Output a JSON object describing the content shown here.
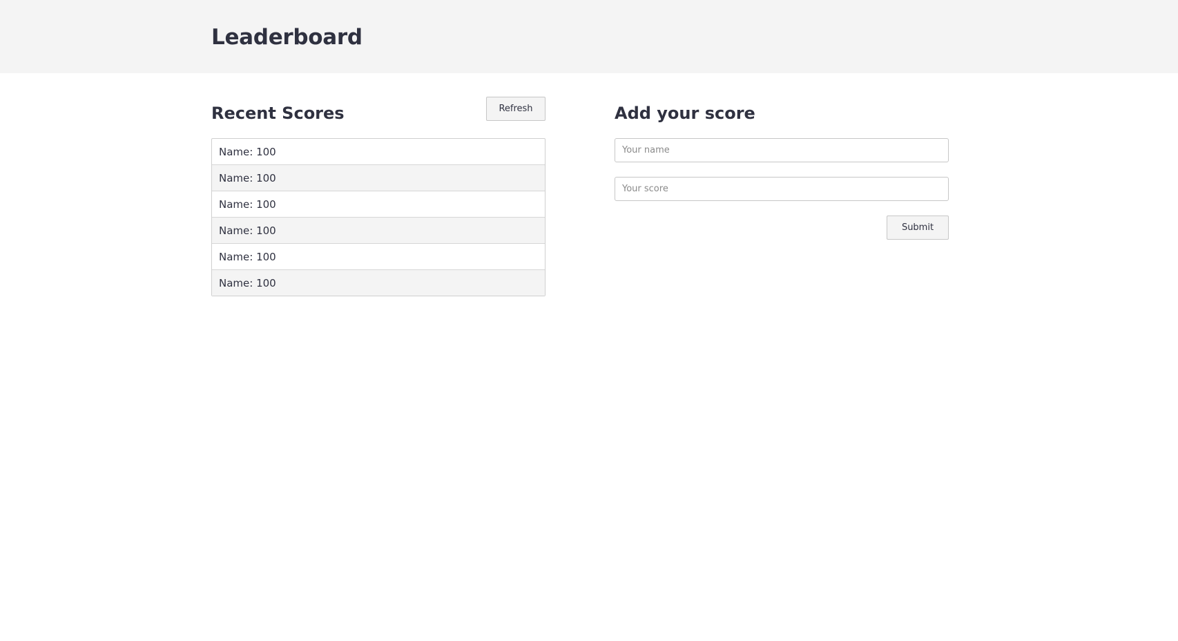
{
  "header": {
    "title": "Leaderboard"
  },
  "recent": {
    "title": "Recent Scores",
    "refresh_label": "Refresh",
    "items": [
      {
        "label": "Name: 100"
      },
      {
        "label": "Name: 100"
      },
      {
        "label": "Name: 100"
      },
      {
        "label": "Name: 100"
      },
      {
        "label": "Name: 100"
      },
      {
        "label": "Name: 100"
      }
    ]
  },
  "form": {
    "title": "Add your score",
    "name_placeholder": "Your name",
    "score_placeholder": "Your score",
    "submit_label": "Submit"
  },
  "colors": {
    "header_bg": "#f4f4f4",
    "text": "#2f3140",
    "striped_row": "#f4f4f4",
    "border": "#c6c6c6"
  }
}
